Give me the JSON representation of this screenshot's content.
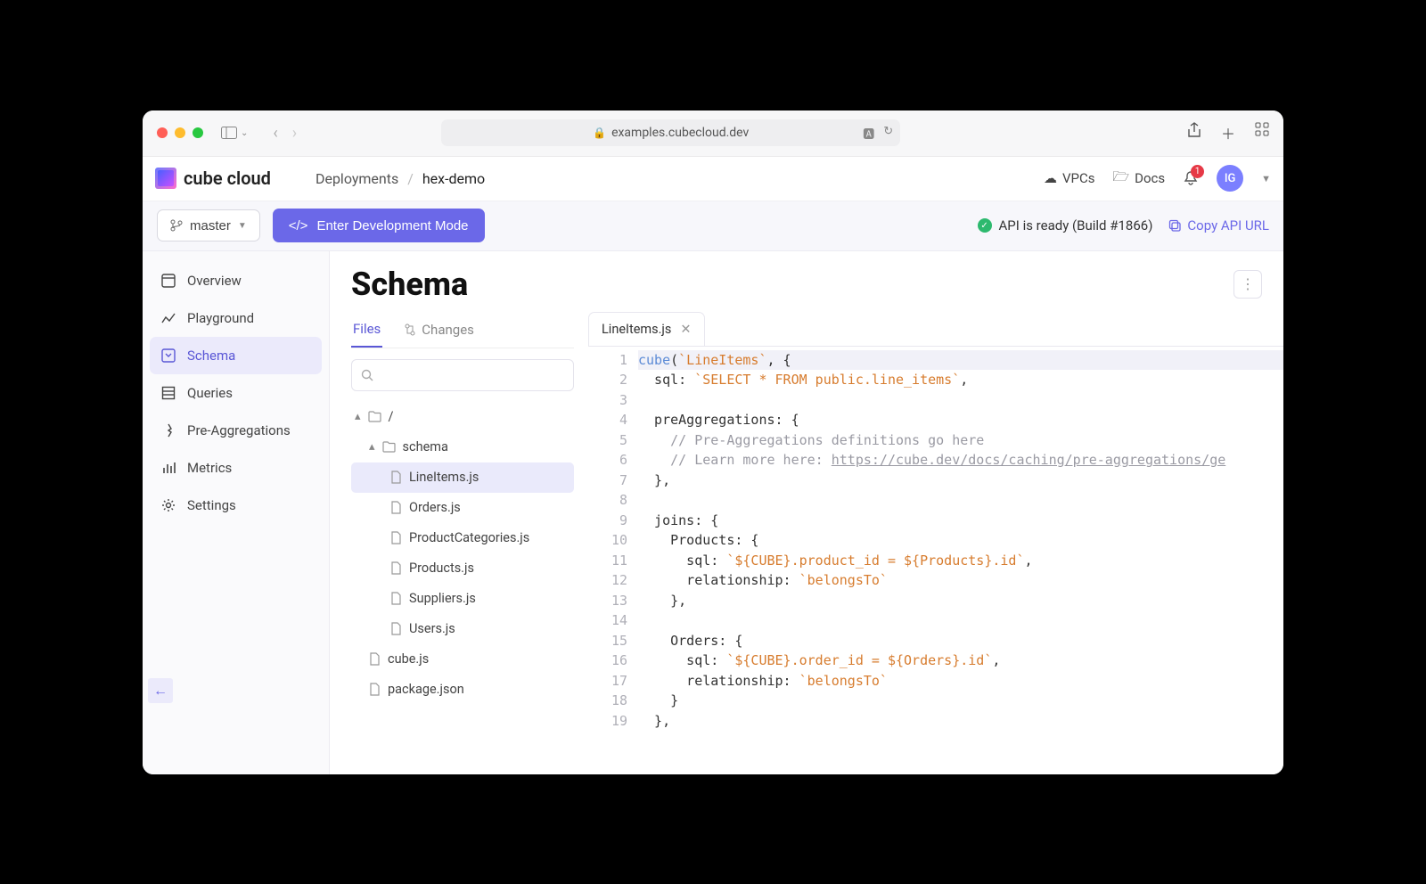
{
  "browser": {
    "url": "examples.cubecloud.dev"
  },
  "app": {
    "logo_text": "cube cloud",
    "breadcrumb_root": "Deployments",
    "breadcrumb_current": "hex-demo"
  },
  "header_right": {
    "vpcs": "VPCs",
    "docs": "Docs",
    "notification_count": "1",
    "avatar_initials": "IG"
  },
  "subheader": {
    "branch": "master",
    "dev_mode_label": "Enter Development Mode",
    "api_status": "API is ready (Build #1866)",
    "copy_api": "Copy API URL"
  },
  "nav": {
    "items": [
      {
        "id": "overview",
        "label": "Overview"
      },
      {
        "id": "playground",
        "label": "Playground"
      },
      {
        "id": "schema",
        "label": "Schema"
      },
      {
        "id": "queries",
        "label": "Queries"
      },
      {
        "id": "preagg",
        "label": "Pre-Aggregations"
      },
      {
        "id": "metrics",
        "label": "Metrics"
      },
      {
        "id": "settings",
        "label": "Settings"
      }
    ],
    "active": "schema"
  },
  "page": {
    "title": "Schema"
  },
  "file_tabs": {
    "files": "Files",
    "changes": "Changes"
  },
  "tree": {
    "root": "/",
    "folder": "schema",
    "files_schema": [
      "LineItems.js",
      "Orders.js",
      "ProductCategories.js",
      "Products.js",
      "Suppliers.js",
      "Users.js"
    ],
    "files_root": [
      "cube.js",
      "package.json"
    ],
    "selected": "LineItems.js"
  },
  "editor": {
    "tab_name": "LineItems.js",
    "lines": [
      {
        "n": 1,
        "html": "<span class='tok-fn'>cube</span>(<span class='tok-str'>`LineItems`</span>, {"
      },
      {
        "n": 2,
        "html": "  sql: <span class='tok-str'>`SELECT * FROM public.line_items`</span>,"
      },
      {
        "n": 3,
        "html": ""
      },
      {
        "n": 4,
        "html": "  preAggregations: {"
      },
      {
        "n": 5,
        "html": "    <span class='tok-cmt'>// Pre-Aggregations definitions go here</span>"
      },
      {
        "n": 6,
        "html": "    <span class='tok-cmt'>// Learn more here: </span><span class='tok-url'>https://cube.dev/docs/caching/pre-aggregations/ge</span>"
      },
      {
        "n": 7,
        "html": "  },"
      },
      {
        "n": 8,
        "html": ""
      },
      {
        "n": 9,
        "html": "  joins: {"
      },
      {
        "n": 10,
        "html": "    Products: {"
      },
      {
        "n": 11,
        "html": "      sql: <span class='tok-str'>`${CUBE}.product_id = ${Products}.id`</span>,"
      },
      {
        "n": 12,
        "html": "      relationship: <span class='tok-str'>`belongsTo`</span>"
      },
      {
        "n": 13,
        "html": "    },"
      },
      {
        "n": 14,
        "html": ""
      },
      {
        "n": 15,
        "html": "    Orders: {"
      },
      {
        "n": 16,
        "html": "      sql: <span class='tok-str'>`${CUBE}.order_id = ${Orders}.id`</span>,"
      },
      {
        "n": 17,
        "html": "      relationship: <span class='tok-str'>`belongsTo`</span>"
      },
      {
        "n": 18,
        "html": "    }"
      },
      {
        "n": 19,
        "html": "  },"
      }
    ]
  }
}
